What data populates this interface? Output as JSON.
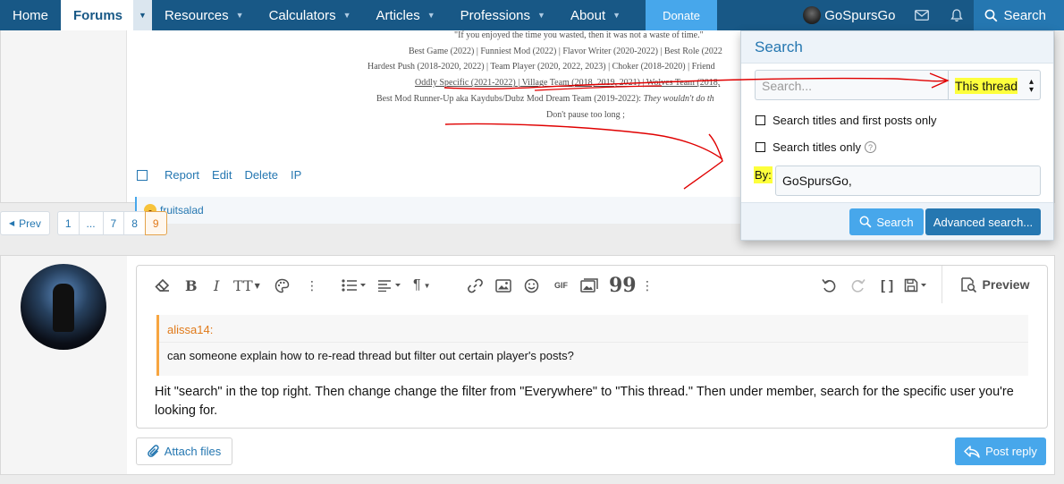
{
  "nav": {
    "home": "Home",
    "forums": "Forums",
    "resources": "Resources",
    "calculators": "Calculators",
    "articles": "Articles",
    "professions": "Professions",
    "about": "About",
    "donate": "Donate",
    "username": "GoSpursGo",
    "search": "Search"
  },
  "signature": {
    "lines": [
      "\"If you enjoyed the time you wasted, then it was not a waste of time.\"",
      "Best Game (2022)  |  Funniest Mod (2022)  |  Flavor Writer (2020-2022)  |  Best Role (2022",
      "Hardest Push (2018-2020, 2022)  |  Team Player (2020, 2022, 2023)  |  Choker (2018-2020)  |  Friend",
      "Oddly Specific (2021-2022)  |  Village Team (2018, 2019, 2021)  |  Wolves Team (2018,",
      "Best Mod Runner-Up aka Kaydubs/Dubz Mod Dream Team (2019-2022):",
      "Don't pause too long ;"
    ],
    "italic_tail": "They wouldn't do th"
  },
  "post_actions": {
    "report": "Report",
    "edit": "Edit",
    "delete": "Delete",
    "ip": "IP"
  },
  "reaction": {
    "user": "fruitsalad"
  },
  "pagination": {
    "prev": "Prev",
    "pages": [
      "1",
      "...",
      "7",
      "8",
      "9"
    ],
    "current": "9"
  },
  "editor": {
    "preview": "Preview",
    "quote_author": "alissa14:",
    "quote_text": "can someone explain how to re-read thread but filter out certain player's posts?",
    "body": "Hit \"search\" in the top right. Then change change the filter from \"Everywhere\" to \"This thread.\" Then under member, search for the specific user you're looking for.",
    "gif_label": "GIF"
  },
  "attach_label": "Attach files",
  "post_reply_label": "Post reply",
  "search_menu": {
    "title": "Search",
    "placeholder": "Search...",
    "scope": "This thread",
    "opt_titles_first": "Search titles and first posts only",
    "opt_titles_only": "Search titles only",
    "help": "?",
    "by_label": "By:",
    "by_value": "GoSpursGo,",
    "search_btn": "Search",
    "advanced_btn": "Advanced search..."
  },
  "colors": {
    "nav_bg": "#185886",
    "accent": "#2577b1",
    "light_accent": "#47a7eb",
    "highlight": "#fdff3c",
    "annotation": "#e00000"
  }
}
